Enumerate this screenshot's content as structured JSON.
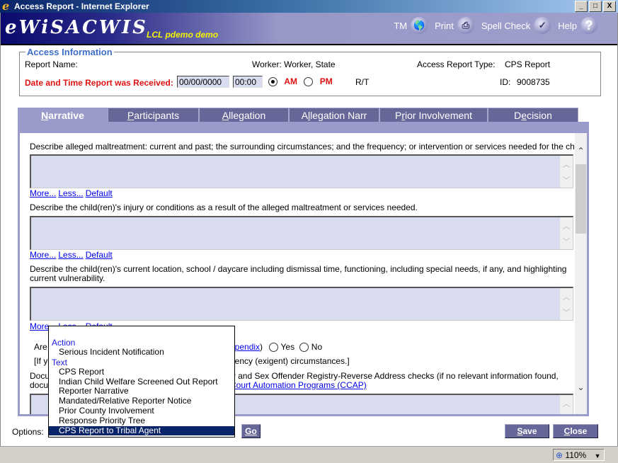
{
  "window": {
    "title": "Access Report - Internet Explorer",
    "buttons": [
      "_",
      "□",
      "X"
    ]
  },
  "banner": {
    "logo": "eWiSACWIS",
    "environment": "LCL pdemo demo",
    "toolbar": [
      {
        "label": "TM",
        "icon": "globe-icon"
      },
      {
        "label": "Print",
        "icon": "printer-icon"
      },
      {
        "label": "Spell Check",
        "icon": "spell-check-icon"
      },
      {
        "label": "Help",
        "icon": "help-icon"
      }
    ]
  },
  "access_info": {
    "legend": "Access Information",
    "report_name_label": "Report Name:",
    "worker": "Worker: Worker, State",
    "report_type_label": "Access Report Type:",
    "report_type_value": "CPS Report",
    "date_time_label": "Date and Time Report was Received:",
    "date_value": "00/00/0000",
    "time_value": "00:00",
    "am_label": "AM",
    "pm_label": "PM",
    "am_pm_selected": "AM",
    "rt_label": "R/T",
    "id_label": "ID:",
    "id_value": "9008735"
  },
  "tabs": [
    {
      "label": "Narrative",
      "accesskey_index": 0,
      "active": true
    },
    {
      "label": "Participants",
      "accesskey_index": 0,
      "active": false
    },
    {
      "label": "Allegation",
      "accesskey_index": 0,
      "active": false
    },
    {
      "label": "Allegation Narr",
      "accesskey_index": 1,
      "active": false
    },
    {
      "label": "Prior Involvement",
      "accesskey_index": 1,
      "active": false
    },
    {
      "label": "Decision",
      "accesskey_index": 1,
      "active": false
    }
  ],
  "narrative": {
    "q1": "Describe alleged maltreatment: current and past; the surrounding circumstances; and the frequency; or intervention or services needed for the child.",
    "q2": "Describe the child(ren)'s injury or conditions as a result of the alleged maltreatment or services needed.",
    "q3_line1": "Describe the child(ren)'s current location, school / daycare including dismissal time, functioning, including special needs, if any, and highlighting",
    "q3_line2": "current vulnerability.",
    "links": {
      "more": "More...",
      "less": "Less...",
      "default": "Default"
    },
    "q4_prefix": "Are t",
    "q4_link_tail": "ppendix",
    "q4_suffix": ")",
    "yes_label": "Yes",
    "no_label": "No",
    "q5_prefix": "[If ye",
    "q5_tail": "gency (exigent) circumstances.]",
    "q6_prefix_line1": "Docu",
    "q6_prefix_line2": "docu",
    "q6_tail_line1": "P and Sex Offender Registry-Reverse Address checks (if no relevant information found,",
    "q6_link": "Court Automation Programs (CCAP)"
  },
  "options": {
    "label": "Options:",
    "go_label": "Go",
    "dropdown": {
      "groups": [
        {
          "name": "Action",
          "items": [
            "Serious Incident Notification"
          ]
        },
        {
          "name": "Text",
          "items": [
            "CPS Report",
            "Indian Child Welfare Screened Out Report",
            "Reporter Narrative",
            "Mandated/Relative Reporter Notice",
            "Prior County Involvement",
            "Response Priority Tree",
            "CPS Report to Tribal Agent"
          ]
        }
      ],
      "selected": "CPS Report to Tribal Agent"
    }
  },
  "footer": {
    "save_label": "Save",
    "close_label": "Close"
  },
  "statusbar": {
    "zoom": "110%"
  }
}
